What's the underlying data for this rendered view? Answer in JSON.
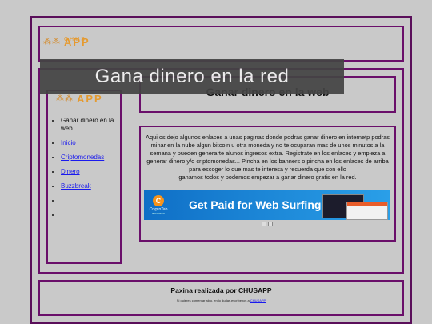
{
  "header": {
    "logo_small": "CHUS",
    "logo_big": "APP",
    "logo_dots": "⁂⁂"
  },
  "banner": {
    "text": "Gana dinero en la red"
  },
  "sidebar": {
    "logo_big": "APP",
    "items": [
      {
        "label": "Ganar dinero en la web",
        "link": false
      },
      {
        "label": "Inicio",
        "link": true
      },
      {
        "label": "Criptomonedas",
        "link": true
      },
      {
        "label": "Dinero",
        "link": true
      },
      {
        "label": "Buzzbreak",
        "link": true
      },
      {
        "label": "",
        "link": false
      },
      {
        "label": "",
        "link": false
      }
    ]
  },
  "main": {
    "title": "Ganar dinero en la web",
    "paragraph": "Aqui os dejo algunos enlaces a unas paginas donde podras ganar dinero en internetp podras minar en la nube algun bitcoin u otra moneda y no te ocuparan mas de unos minutos a la semana y pueden generarte alunos ingresos extra. Registrate en los enlaces y empieza a generar dinero y/o criptomonedas... Pincha en los banners o pincha en los enlaces de arriba para escoger lo que mas te interesa y recuerda que con ello",
    "paragraph_end": "ganamos todos y podemos empezar a ganar dinero gratis en la red."
  },
  "ad": {
    "brand": "CryptoTab",
    "brand_sub": "BROWSER",
    "coin": "C",
    "headline": "Get Paid for Web Surfing"
  },
  "footer": {
    "title": "Paxina realizada por CHUSAPP",
    "small_text": "Si quieres comentar algo, en lo dudas,escribenos a ",
    "link": "CHUSAPP"
  },
  "colors": {
    "border": "#6a0f6a",
    "background": "#c9c9c9",
    "logo": "#e59a30",
    "link": "#1a1aee"
  }
}
